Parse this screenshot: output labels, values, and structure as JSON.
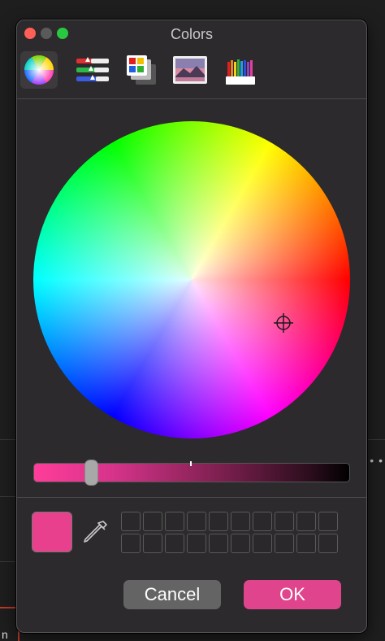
{
  "window": {
    "title": "Colors"
  },
  "toolbar": {
    "tabs": [
      {
        "name": "color-wheel",
        "icon": "color-wheel-icon",
        "active": true
      },
      {
        "name": "color-sliders",
        "icon": "sliders-icon",
        "active": false
      },
      {
        "name": "color-palettes",
        "icon": "palettes-icon",
        "active": false
      },
      {
        "name": "image-palettes",
        "icon": "image-icon",
        "active": false
      },
      {
        "name": "pencils",
        "icon": "pencils-icon",
        "active": false
      }
    ]
  },
  "colors": {
    "selected": "#e8408c",
    "ok_button": "#e0448c",
    "cancel_button": "#646464"
  },
  "brightness": {
    "value": 0.17
  },
  "swatches": {
    "rows": 2,
    "columns": 10,
    "filled": []
  },
  "buttons": {
    "cancel": "Cancel",
    "ok": "OK"
  }
}
